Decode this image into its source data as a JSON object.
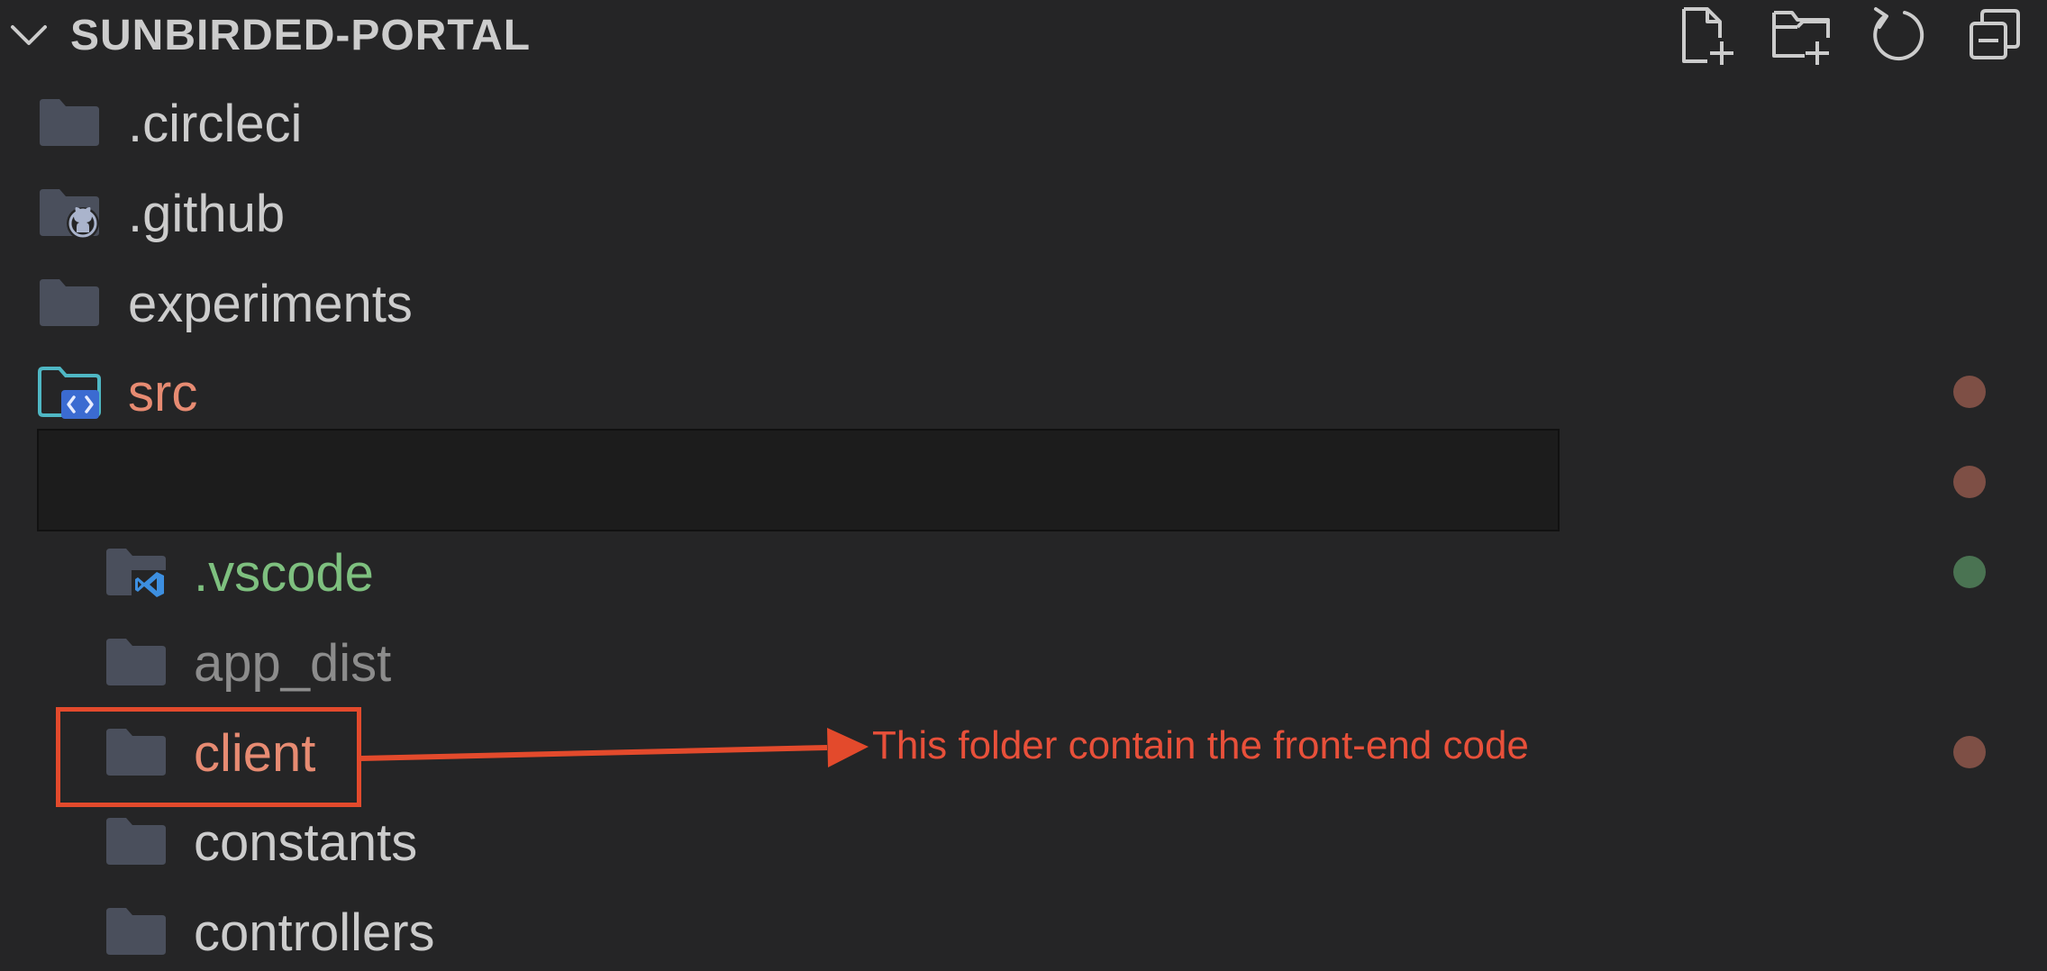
{
  "explorer": {
    "title": "SUNBIRDED-PORTAL",
    "toolbar": [
      {
        "name": "new-file-icon",
        "tooltip": "New File"
      },
      {
        "name": "new-folder-icon",
        "tooltip": "New Folder"
      },
      {
        "name": "refresh-icon",
        "tooltip": "Refresh Explorer"
      },
      {
        "name": "collapse-all-icon",
        "tooltip": "Collapse Folders in View"
      }
    ],
    "items": [
      {
        "label": ".circleci",
        "icon": "folder-icon",
        "level": 0,
        "status": "default"
      },
      {
        "label": ".github",
        "icon": "github-folder-icon",
        "level": 0,
        "status": "default"
      },
      {
        "label": "experiments",
        "icon": "folder-icon",
        "level": 0,
        "status": "default"
      },
      {
        "label": "src",
        "icon": "src-folder-icon",
        "level": 0,
        "status": "modified"
      },
      {
        "label": "",
        "icon": "",
        "level": 1,
        "status": "modified",
        "redacted": true
      },
      {
        "label": ".vscode",
        "icon": "vscode-folder-icon",
        "level": 1,
        "status": "added"
      },
      {
        "label": "app_dist",
        "icon": "folder-icon",
        "level": 1,
        "status": "ignored"
      },
      {
        "label": "client",
        "icon": "folder-icon",
        "level": 1,
        "status": "modified"
      },
      {
        "label": "constants",
        "icon": "folder-icon",
        "level": 1,
        "status": "default"
      },
      {
        "label": "controllers",
        "icon": "folder-icon",
        "level": 1,
        "status": "default"
      }
    ]
  },
  "annotation": {
    "text": "This folder contain the front-end code"
  },
  "colors": {
    "background": "#252526",
    "text": "#cccccc",
    "modified": "#e78b72",
    "added": "#7ec07f",
    "ignored": "#8c8c8c",
    "folder": "#4a4f5c",
    "annotation": "#e34a2c",
    "modified_dot": "#7e4f45",
    "added_dot": "#4a7352"
  }
}
